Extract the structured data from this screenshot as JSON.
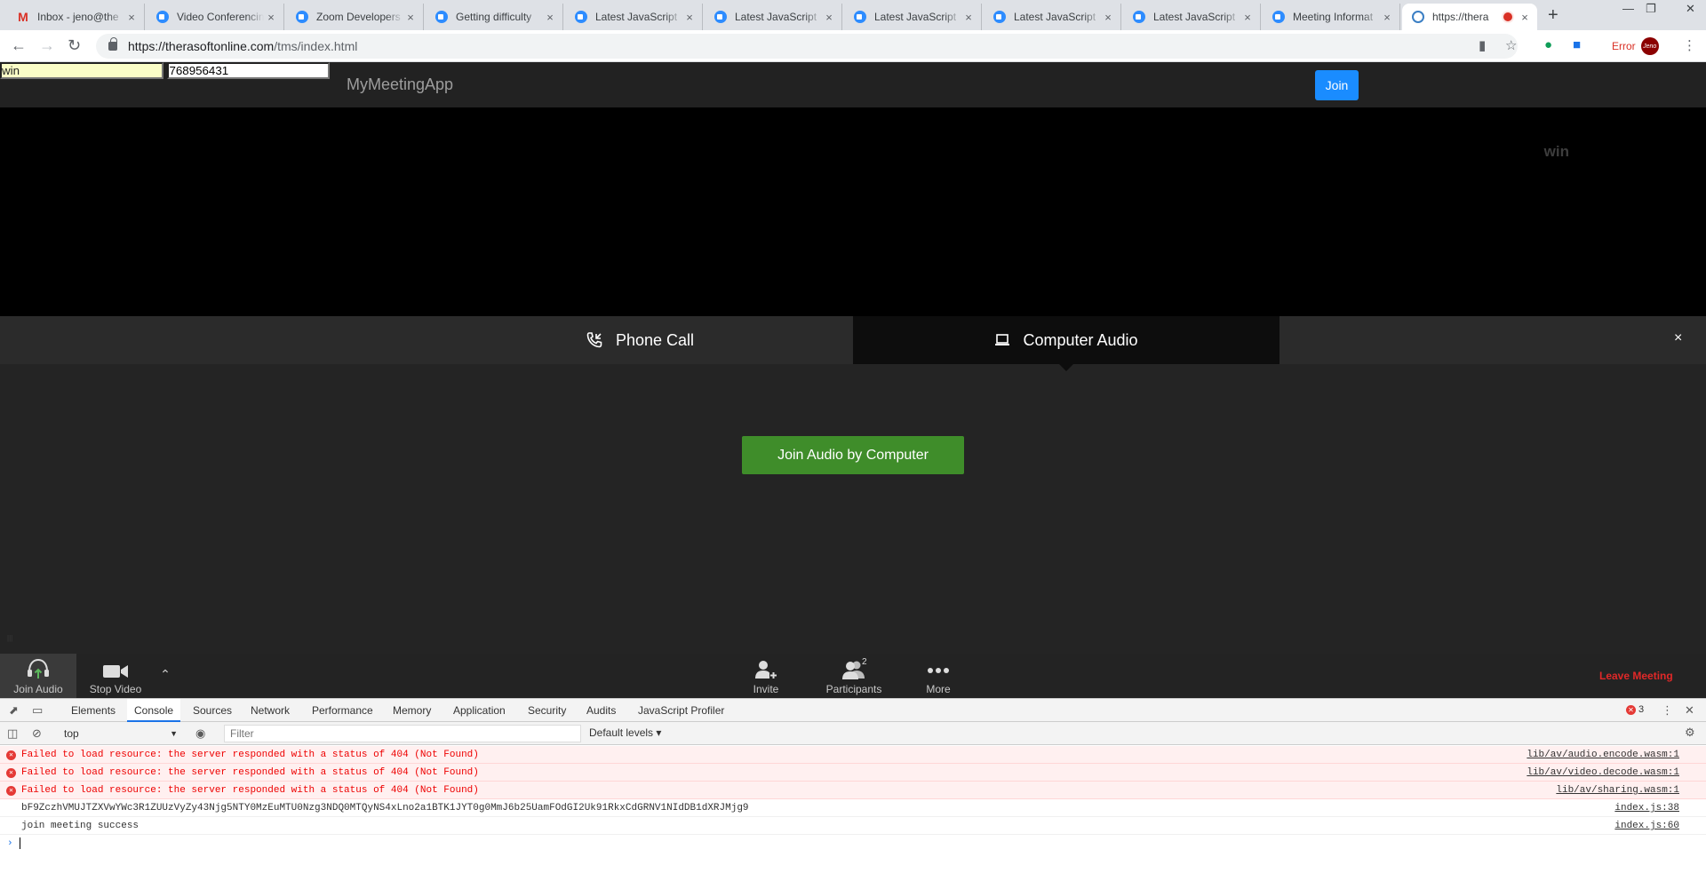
{
  "browser": {
    "tabs": [
      {
        "title": "Inbox - jeno@the",
        "icon": "gmail-icon"
      },
      {
        "title": "Video Conferencing",
        "icon": "zoom-icon"
      },
      {
        "title": "Zoom Developers",
        "icon": "zoom-icon"
      },
      {
        "title": "Getting difficulty",
        "icon": "zoom-icon"
      },
      {
        "title": "Latest JavaScript",
        "icon": "zoom-icon"
      },
      {
        "title": "Latest JavaScript",
        "icon": "zoom-icon"
      },
      {
        "title": "Latest JavaScript",
        "icon": "zoom-icon"
      },
      {
        "title": "Latest JavaScript",
        "icon": "zoom-icon"
      },
      {
        "title": "Latest JavaScript",
        "icon": "zoom-icon"
      },
      {
        "title": "Meeting Informat",
        "icon": "zoom-icon"
      },
      {
        "title": "https://thera",
        "icon": "wordpress-icon",
        "active": true
      }
    ],
    "url_host": "https://therasoftonline.com",
    "url_path": "/tms/index.html",
    "error_label": "Error",
    "avatar_text": "Jeno"
  },
  "header": {
    "brand": "MyMeetingApp",
    "name_value": "win",
    "meeting_id_value": "768956431",
    "join_label": "Join"
  },
  "video": {
    "self_name": "win"
  },
  "audio_panel": {
    "tab_phone": "Phone Call",
    "tab_computer": "Computer Audio",
    "active_tab": "Computer Audio",
    "join_button": "Join Audio by Computer",
    "close_symbol": "×"
  },
  "controls": {
    "join_audio": "Join Audio",
    "stop_video": "Stop Video",
    "invite": "Invite",
    "participants": "Participants",
    "participant_count": "2",
    "more": "More",
    "leave": "Leave Meeting"
  },
  "devtools": {
    "tabs": [
      "Elements",
      "Console",
      "Sources",
      "Network",
      "Performance",
      "Memory",
      "Application",
      "Security",
      "Audits",
      "JavaScript Profiler"
    ],
    "active_tab": "Console",
    "error_count": "3",
    "context": "top",
    "filter_placeholder": "Filter",
    "levels": "Default levels",
    "messages": [
      {
        "type": "error",
        "text": "Failed to load resource: the server responded with a status of 404 (Not Found)",
        "source": "lib/av/audio.encode.wasm:1"
      },
      {
        "type": "error",
        "text": "Failed to load resource: the server responded with a status of 404 (Not Found)",
        "source": "lib/av/video.decode.wasm:1"
      },
      {
        "type": "error",
        "text": "Failed to load resource: the server responded with a status of 404 (Not Found)",
        "source": "lib/av/sharing.wasm:1"
      },
      {
        "type": "log",
        "text": "bF9ZczhVMUJTZXVwYWc3R1ZUUzVyZy43Njg5NTY0MzEuMTU0Nzg3NDQ0MTQyNS4xLno2a1BTK1JYT0g0MmJ6b25UamFOdGI2Uk91RkxCdGRNV1NIdDB1dXRJMjg9",
        "source": "index.js:38"
      },
      {
        "type": "log",
        "text": "join meeting success",
        "source": "index.js:60"
      }
    ]
  },
  "colors": {
    "join_blue": "#1a8cff",
    "join_audio_green": "#3f8d2a",
    "leave_red": "#e02828",
    "console_error": "#e00"
  }
}
